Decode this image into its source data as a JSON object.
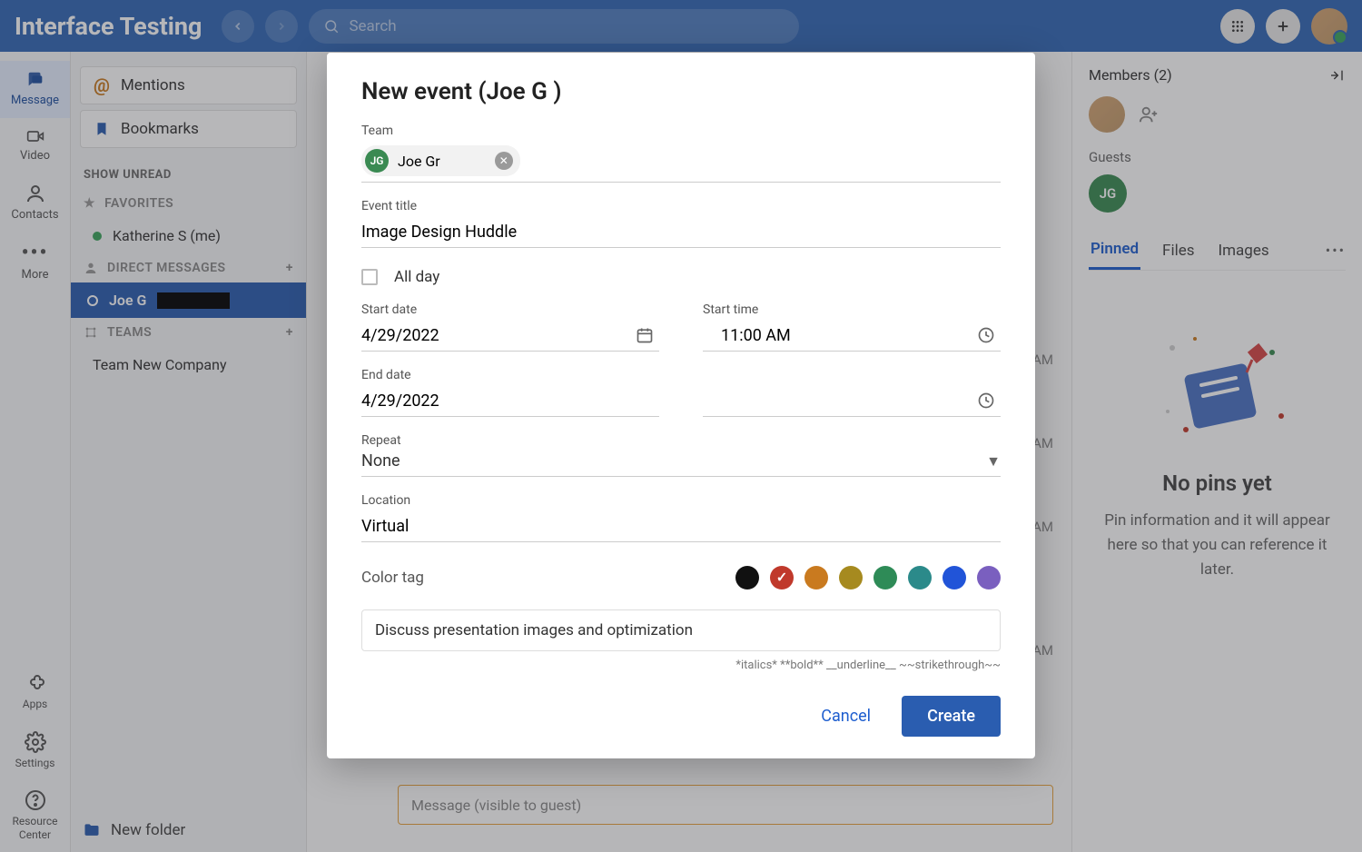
{
  "header": {
    "app_title": "Interface Testing",
    "search_placeholder": "Search"
  },
  "rail": {
    "message": "Message",
    "video": "Video",
    "contacts": "Contacts",
    "more": "More",
    "apps": "Apps",
    "settings": "Settings",
    "resource_center": "Resource Center"
  },
  "sidebar": {
    "mentions": "Mentions",
    "bookmarks": "Bookmarks",
    "show_unread": "SHOW UNREAD",
    "favorites": "FAVORITES",
    "me_entry": "Katherine S (me)",
    "dm_header": "DIRECT MESSAGES",
    "dm_entry_name": "Joe G",
    "teams_header": "TEAMS",
    "team_entry": "Team New Company",
    "new_folder": "New folder"
  },
  "center": {
    "times": [
      "AM",
      "AM",
      "AM",
      "AM"
    ],
    "message_placeholder": "Message (visible to guest)"
  },
  "rpanel": {
    "members_label": "Members (2)",
    "guests_label": "Guests",
    "guest_initials": "JG",
    "tabs": {
      "pinned": "Pinned",
      "files": "Files",
      "images": "Images"
    },
    "empty_title": "No pins yet",
    "empty_body": "Pin information and it will appear here so that you can reference it later."
  },
  "modal": {
    "title": "New event (Joe G             )",
    "team_label": "Team",
    "team_chip_initials": "JG",
    "team_chip_name": "Joe Gr",
    "event_title_label": "Event title",
    "event_title_value": "Image Design Huddle",
    "all_day": "All day",
    "start_date_label": "Start date",
    "start_date_value": "4/29/2022",
    "start_time_label": "Start time",
    "start_time_value": "11:00 AM",
    "end_date_label": "End date",
    "end_date_value": "4/29/2022",
    "end_time_value": "",
    "repeat_label": "Repeat",
    "repeat_value": "None",
    "location_label": "Location",
    "location_value": "Virtual",
    "color_tag_label": "Color tag",
    "colors": [
      "#111111",
      "#c0392b",
      "#c97a1f",
      "#a68a1f",
      "#2e8b57",
      "#2b8a8a",
      "#2154d8",
      "#7a5fbf"
    ],
    "selected_color_index": 1,
    "description_value": "Discuss presentation images and optimization",
    "format_hint": "*italics* **bold** __underline__ ~~strikethrough~~",
    "cancel": "Cancel",
    "create": "Create"
  }
}
